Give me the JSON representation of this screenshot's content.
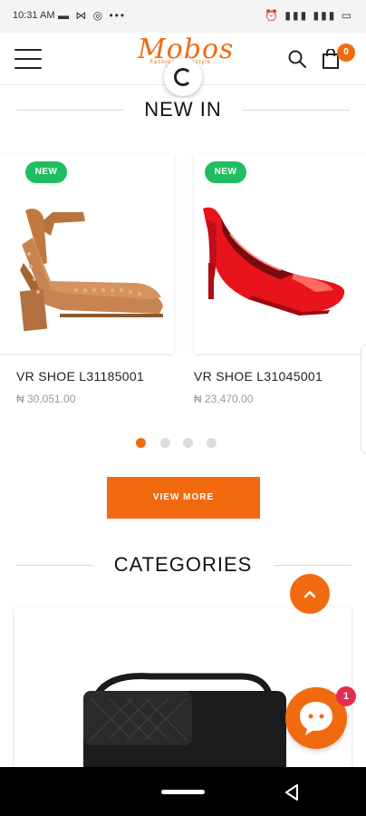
{
  "status_bar": {
    "time": "10:31 AM"
  },
  "header": {
    "logo_brand": "Mobos",
    "logo_tagline": "Fashion · Lifestyle · Innovation",
    "cart_count": "0"
  },
  "new_in": {
    "title": "NEW IN",
    "badge": "NEW",
    "products": [
      {
        "name": "VR SHOE L31185001",
        "price": "₦ 30,051.00"
      },
      {
        "name": "VR SHOE L31045001",
        "price": "₦ 23,470.00"
      }
    ],
    "pagination": {
      "total": 4,
      "active": 1
    },
    "view_more_label": "VIEW MORE"
  },
  "categories": {
    "title": "CATEGORIES"
  },
  "chat": {
    "unread": "1"
  },
  "colors": {
    "accent": "#f26a10",
    "badge_green": "#1fbe61",
    "chat_badge": "#e52b50"
  }
}
